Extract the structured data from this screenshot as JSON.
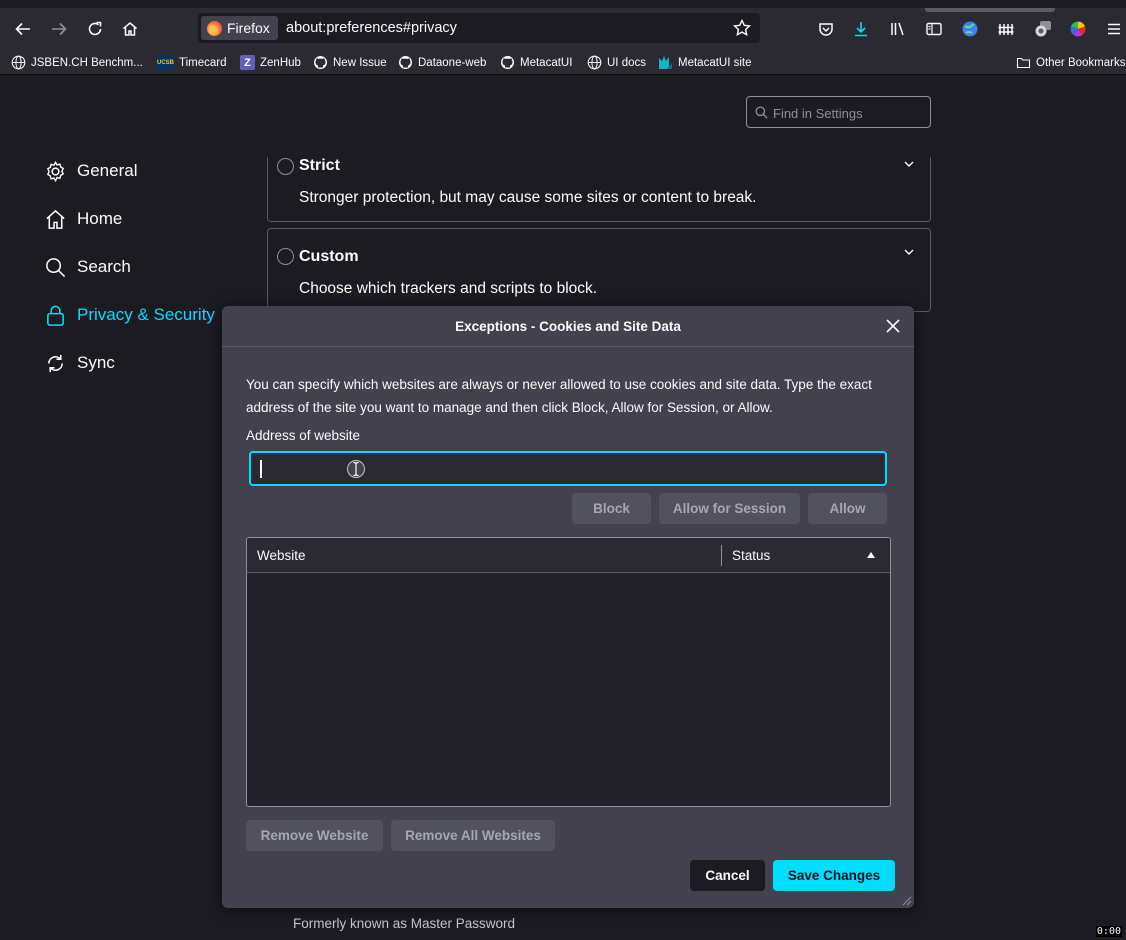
{
  "browser": {
    "identity_label": "Firefox",
    "url": "about:preferences#privacy"
  },
  "bookmarks": [
    {
      "label": "JSBEN.CH Benchm...",
      "icon": "globe-icon"
    },
    {
      "label": "Timecard",
      "icon": "ucsb-icon",
      "icon_text": "UCSB"
    },
    {
      "label": "ZenHub",
      "icon": "zenhub-icon",
      "icon_text": "Z"
    },
    {
      "label": "New Issue",
      "icon": "github-icon"
    },
    {
      "label": "Dataone-web",
      "icon": "github-icon"
    },
    {
      "label": "MetacatUI",
      "icon": "github-icon"
    },
    {
      "label": "UI docs",
      "icon": "globe-icon"
    },
    {
      "label": "MetacatUI site",
      "icon": "metacat-icon"
    },
    {
      "label": "Other Bookmarks",
      "icon": "folder-icon"
    }
  ],
  "settings": {
    "find_placeholder": "Find in Settings",
    "nav": [
      {
        "label": "General",
        "icon": "gear-icon"
      },
      {
        "label": "Home",
        "icon": "home-icon"
      },
      {
        "label": "Search",
        "icon": "search-icon"
      },
      {
        "label": "Privacy & Security",
        "icon": "lock-icon",
        "active": true
      },
      {
        "label": "Sync",
        "icon": "sync-icon"
      }
    ],
    "protection_options": [
      {
        "title": "Strict",
        "description": "Stronger protection, but may cause some sites or content to break."
      },
      {
        "title": "Custom",
        "description": "Choose which trackers and scripts to block."
      }
    ],
    "footnote": "Formerly known as Master Password"
  },
  "dialog": {
    "title": "Exceptions - Cookies and Site Data",
    "intro": "You can specify which websites are always or never allowed to use cookies and site data. Type the exact address of the site you want to manage and then click Block, Allow for Session, or Allow.",
    "address_label": "Address of website",
    "address_value": "",
    "buttons": {
      "block": "Block",
      "allow_session": "Allow for Session",
      "allow": "Allow",
      "remove_website": "Remove Website",
      "remove_all": "Remove All Websites",
      "cancel": "Cancel",
      "save": "Save Changes"
    },
    "table": {
      "columns": [
        "Website",
        "Status"
      ],
      "rows": []
    }
  },
  "overlay_timer": "0:00",
  "colors": {
    "accent": "#00ddff",
    "background": "#1c1b22",
    "dialog_bg": "#42414d"
  }
}
